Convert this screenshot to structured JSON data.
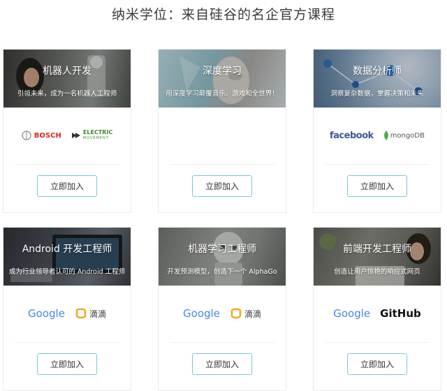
{
  "page": {
    "title": "纳米学位：来自硅谷的名企官方课程"
  },
  "cards": [
    {
      "title": "机器人开发",
      "subtitle": "引领未来，成为一名机器人工程师",
      "logos": {
        "left": "BOSCH",
        "right_line1": "ELECTRIC",
        "right_line2": "MOVEMENT"
      },
      "button": "立即加入"
    },
    {
      "title": "深度学习",
      "subtitle": "用深度学习颠覆音乐、游戏和全世界！",
      "logos": {},
      "button": "立即加入"
    },
    {
      "title": "数据分析师",
      "subtitle": "洞察复杂数据，掌握决策和未来",
      "logos": {
        "left": "facebook",
        "right": "mongoDB"
      },
      "button": "立即加入"
    },
    {
      "title": "Android 开发工程师",
      "subtitle": "成为行业领导者认可的 Android 工程师",
      "logos": {
        "left": "Google",
        "right": "滴滴"
      },
      "button": "立即加入"
    },
    {
      "title": "机器学习工程师",
      "subtitle": "开发预测模型，创造下一个 AlphaGo",
      "logos": {
        "left": "Google",
        "right": "滴滴"
      },
      "button": "立即加入"
    },
    {
      "title": "前端开发工程师",
      "subtitle": "创造让用户惊艳的响应式网页",
      "logos": {
        "left": "Google",
        "right": "GitHub"
      },
      "button": "立即加入"
    }
  ],
  "colors": {
    "button_border": "#7cc6d4",
    "bosch_red": "#e2231a",
    "electric_green": "#3d8c2f",
    "facebook_blue": "#3b5998",
    "mongo_green": "#4fa94d",
    "didi_orange": "#f5a623",
    "google_blue": "#4285f4",
    "google_red": "#ea4335",
    "google_yellow": "#fbbc05",
    "google_green": "#34a853"
  }
}
